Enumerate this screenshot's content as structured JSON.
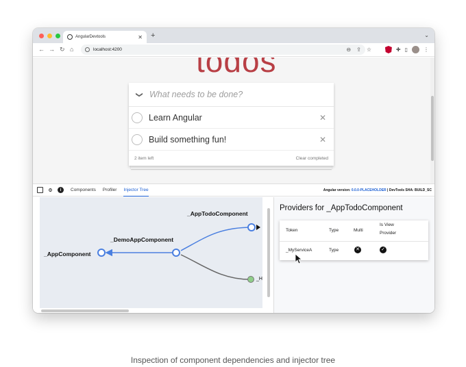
{
  "browser": {
    "tab_title": "AngularDevtools",
    "tab_close": "✕",
    "new_tab": "+",
    "tab_menu": "⌄",
    "url": "localhost:4200",
    "nav": {
      "back": "←",
      "forward": "→",
      "reload": "↻",
      "home": "⌂"
    }
  },
  "app": {
    "title": "todos",
    "new_todo_placeholder": "What needs to be done?",
    "items": [
      {
        "label": "Learn Angular",
        "completed": false
      },
      {
        "label": "Build something fun!",
        "completed": false
      }
    ],
    "items_left": "2 item left",
    "clear_completed": "Clear completed"
  },
  "devtools": {
    "tabs": [
      "Components",
      "Profiler",
      "Injector Tree"
    ],
    "active_tab": "Injector Tree",
    "version_prefix": "Angular version: ",
    "version_value": "0.0.0-PLACEHOLDER",
    "sha_text": " | DevTools SHA: BUILD_SC",
    "graph": {
      "nodes": [
        {
          "label": "_AppComponent"
        },
        {
          "label": "_DemoAppComponent"
        },
        {
          "label": "_AppTodoComponent"
        },
        {
          "label": "_H"
        }
      ]
    },
    "providers": {
      "title": "Providers for _AppTodoComponent",
      "columns": [
        "Token",
        "Type",
        "Multi",
        "Is View Provider"
      ],
      "rows": [
        {
          "token": "_MyServiceA",
          "type": "Type",
          "multi": "✕",
          "is_view_provider": "✓"
        }
      ]
    }
  },
  "caption": "Inspection of component dependencies and injector tree",
  "colors": {
    "accent": "#1a5ed3",
    "todos_title": "#b83f45",
    "node_blue": "#4a7fe0",
    "node_green": "#8fce8a"
  }
}
